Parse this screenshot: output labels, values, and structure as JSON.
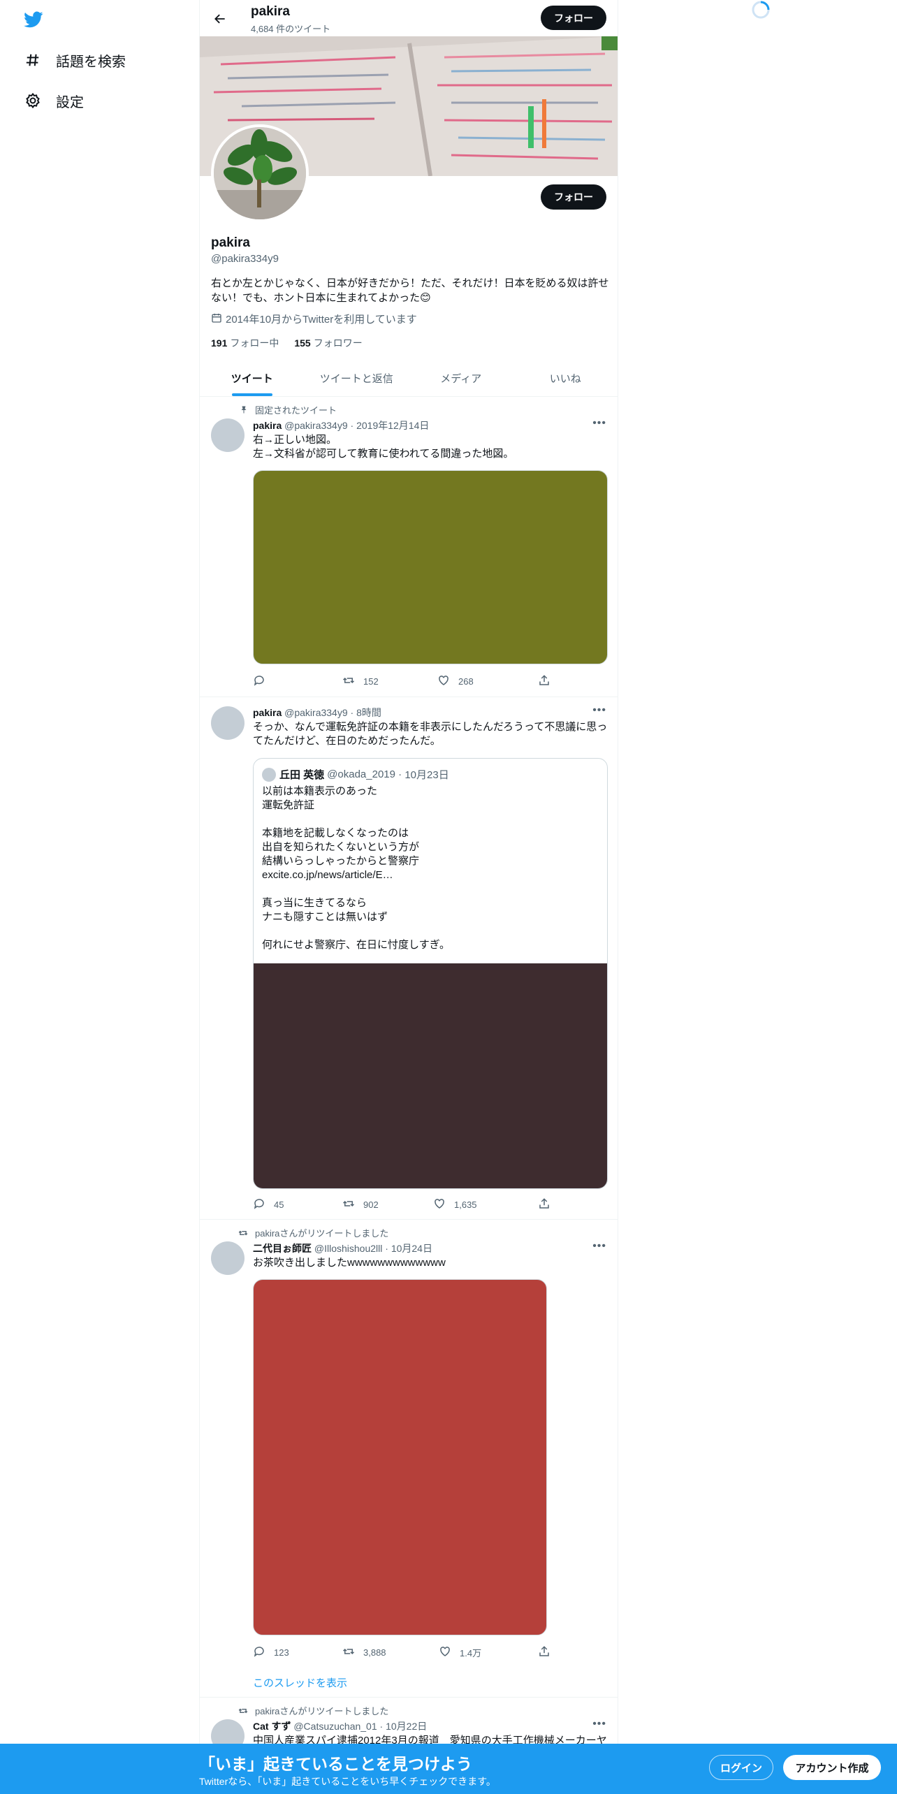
{
  "nav": {
    "logo": "twitter-logo",
    "items": [
      {
        "label": "話題を検索",
        "icon": "hashtag-icon"
      },
      {
        "label": "設定",
        "icon": "gear-icon"
      }
    ]
  },
  "header": {
    "name": "pakira",
    "tweet_count": "4,684 件のツイート",
    "follow_label": "フォロー"
  },
  "profile": {
    "name": "pakira",
    "handle": "@pakira334y9",
    "bio": "右とか左とかじゃなく、日本が好きだから！ただ、それだけ！日本を貶める奴は許せない！でも、ホント日本に生まれてよかった😊",
    "joined": "2014年10月からTwitterを利用しています",
    "following_count": "191",
    "following_label": "フォロー中",
    "followers_count": "155",
    "followers_label": "フォロワー",
    "follow_label": "フォロー"
  },
  "tabs": [
    "ツイート",
    "ツイートと返信",
    "メディア",
    "いいね"
  ],
  "tweets": [
    {
      "social": "固定されたツイート",
      "name": "pakira",
      "handle": "@pakira334y9",
      "date": "2019年12月14日",
      "text": "右→正しい地図。\n左→文科省が認可して教育に使われてる間違った地図。",
      "media_color": "#737820",
      "reply": "",
      "retweet": "152",
      "like": "268"
    },
    {
      "social": "",
      "name": "pakira",
      "handle": "@pakira334y9",
      "date": "8時間",
      "text": "そっか、なんで運転免許証の本籍を非表示にしたんだろうって不思議に思ってたんだけど、在日のためだったんだ。",
      "quote": {
        "name": "丘田 英徳",
        "handle": "@okada_2019",
        "date": "10月23日",
        "text": "以前は本籍表示のあった\n運転免許証\n\n本籍地を記載しなくなったのは\n出自を知られたくないという方が\n結構いらっしゃったからと警察庁\nexcite.co.jp/news/article/E…\n\n真っ当に生きてるなら\nナニも隠すことは無いはず\n\n何れにせよ警察庁、在日に忖度しすぎ。",
        "media_color": "#3e2c2f"
      },
      "reply": "45",
      "retweet": "902",
      "like": "1,635"
    },
    {
      "social": "pakiraさんがリツイートしました",
      "name": "二代目ぉ師匠",
      "handle": "@Illoshishou2lll",
      "date": "10月24日",
      "text": "お茶吹き出しましたwwwwwwwwwwwww",
      "media_color": "#b5403a",
      "reply": "123",
      "retweet": "3,888",
      "like": "1.4万",
      "thread_link": "このスレッドを表示"
    },
    {
      "social": "pakiraさんがリツイートしました",
      "name": "Cat すず",
      "handle": "@Catsuzuchan_01",
      "date": "10月22日",
      "text": "中国人産業スパイ逮捕2012年3月の報道　愛知県の大手工作機械メーカーヤ"
    }
  ],
  "bottom_bar": {
    "title": "「いま」起きていることを見つけよう",
    "subtitle": "Twitterなら、「いま」起きていることをいち早くチェックできます。",
    "login": "ログイン",
    "signup": "アカウント作成"
  }
}
